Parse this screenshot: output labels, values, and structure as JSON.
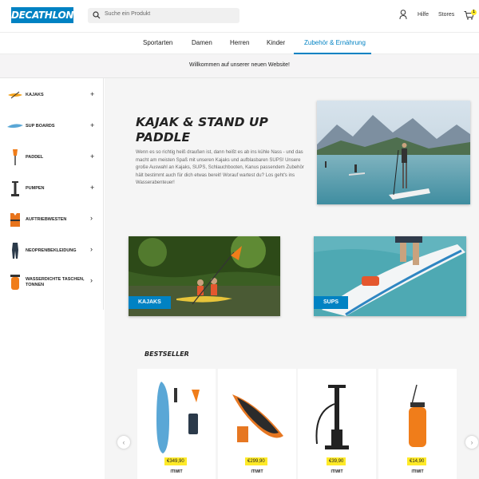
{
  "brand": {
    "logo_text": "DECATHLON",
    "accent": "#0082c3",
    "highlight": "#ffea28"
  },
  "search": {
    "placeholder": "Suche ein Produkt"
  },
  "header": {
    "help": "Hilfe",
    "stores": "Stores",
    "cart_count": "1"
  },
  "nav": {
    "items": [
      "Sportarten",
      "Damen",
      "Herren",
      "Kinder",
      "Zubehör & Ernährung"
    ],
    "active_index": 4
  },
  "banner": {
    "text": "Willkommen auf unserer neuen Website!"
  },
  "sidebar": {
    "items": [
      {
        "label": "KAJAKS",
        "control": "+"
      },
      {
        "label": "SUP BOARDS",
        "control": "+"
      },
      {
        "label": "PADDEL",
        "control": "+"
      },
      {
        "label": "PUMPEN",
        "control": "+"
      },
      {
        "label": "AUFTRIEBWESTEN",
        "control": "›"
      },
      {
        "label": "NEOPRENBEKLEIDUNG",
        "control": "›"
      },
      {
        "label": "WASSERDICHTE TASCHEN, TONNEN",
        "control": "›"
      }
    ]
  },
  "hero": {
    "title": "KAJAK & STAND UP PADDLE",
    "text": "Wenn es so richtig heiß draußen ist, dann heißt es ab ins kühle Nass - und das macht am meisten Spaß mit unseren Kajaks und aufblasbaren SUPS! Unsere große Auswahl an Kajaks, SUPS, Schlauchbooten, Kanus passendem Zubehör hält bestimmt auch für dich etwas bereit! Worauf wartest du? Los geht's ins Wasserabenteuer!"
  },
  "categories": [
    {
      "label": "KAJAKS"
    },
    {
      "label": "SUPS"
    }
  ],
  "bestseller": {
    "title": "BESTSELLER",
    "products": [
      {
        "price": "€349,90",
        "brand": "ITIWIT"
      },
      {
        "price": "€299,90",
        "brand": "ITIWIT"
      },
      {
        "price": "€39,90",
        "brand": "ITIWIT"
      },
      {
        "price": "€14,90",
        "brand": "ITIWIT"
      }
    ]
  }
}
